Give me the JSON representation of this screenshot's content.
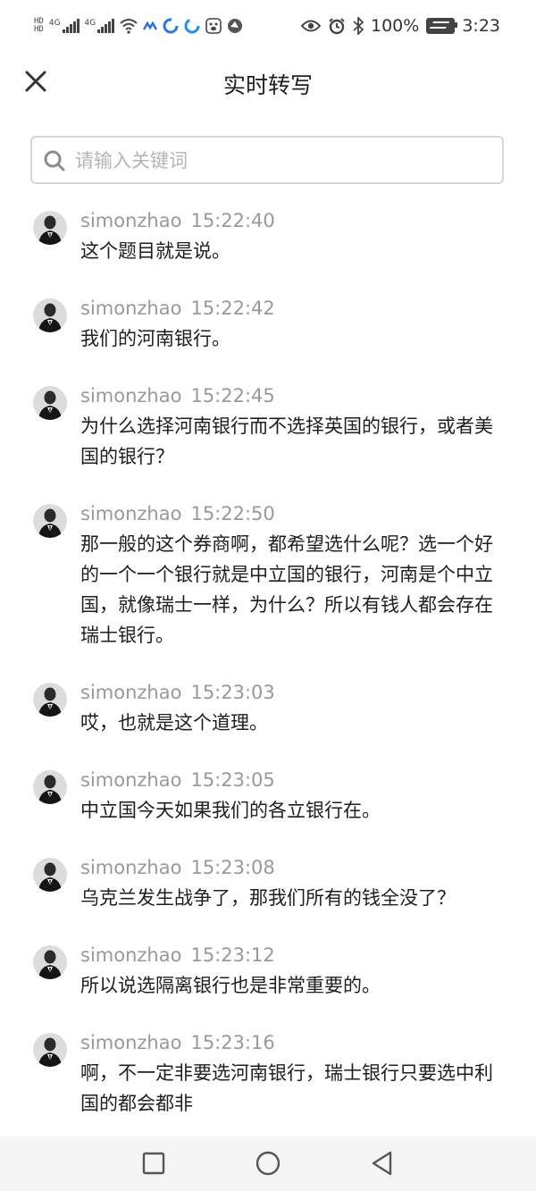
{
  "status_bar": {
    "left_icons": [
      "hd-icon",
      "signal-4g-icon",
      "signal-4g-icon",
      "wifi-icon",
      "app-icon",
      "app-icon",
      "app-icon",
      "paw-icon",
      "app-icon"
    ],
    "sim1_label": "4G",
    "sim2_label": "4G",
    "battery_percent": "100%",
    "time": "3:23"
  },
  "header": {
    "title": "实时转写"
  },
  "search": {
    "placeholder": "请输入关键词",
    "value": ""
  },
  "messages": [
    {
      "user": "simonzhao",
      "time": "15:22:40",
      "text": "这个题目就是说。"
    },
    {
      "user": "simonzhao",
      "time": "15:22:42",
      "text": "我们的河南银行。"
    },
    {
      "user": "simonzhao",
      "time": "15:22:45",
      "text": "为什么选择河南银行而不选择英国的银行，或者美国的银行？"
    },
    {
      "user": "simonzhao",
      "time": "15:22:50",
      "text": "那一般的这个券商啊，都希望选什么呢？选一个好的一个一个银行就是中立国的银行，河南是个中立国，就像瑞士一样，为什么？所以有钱人都会存在瑞士银行。"
    },
    {
      "user": "simonzhao",
      "time": "15:23:03",
      "text": "哎，也就是这个道理。"
    },
    {
      "user": "simonzhao",
      "time": "15:23:05",
      "text": "中立国今天如果我们的各立银行在。"
    },
    {
      "user": "simonzhao",
      "time": "15:23:08",
      "text": "乌克兰发生战争了，那我们所有的钱全没了？"
    },
    {
      "user": "simonzhao",
      "time": "15:23:12",
      "text": "所以说选隔离银行也是非常重要的。"
    },
    {
      "user": "simonzhao",
      "time": "15:23:16",
      "text": "啊，不一定非要选河南银行，瑞士银行只要选中利国的都会都非"
    }
  ],
  "colors": {
    "meta_text": "#999999",
    "body_text": "#1e1e1e",
    "search_border": "#d6d6d6",
    "navbar_bg": "#f5f5f5"
  }
}
